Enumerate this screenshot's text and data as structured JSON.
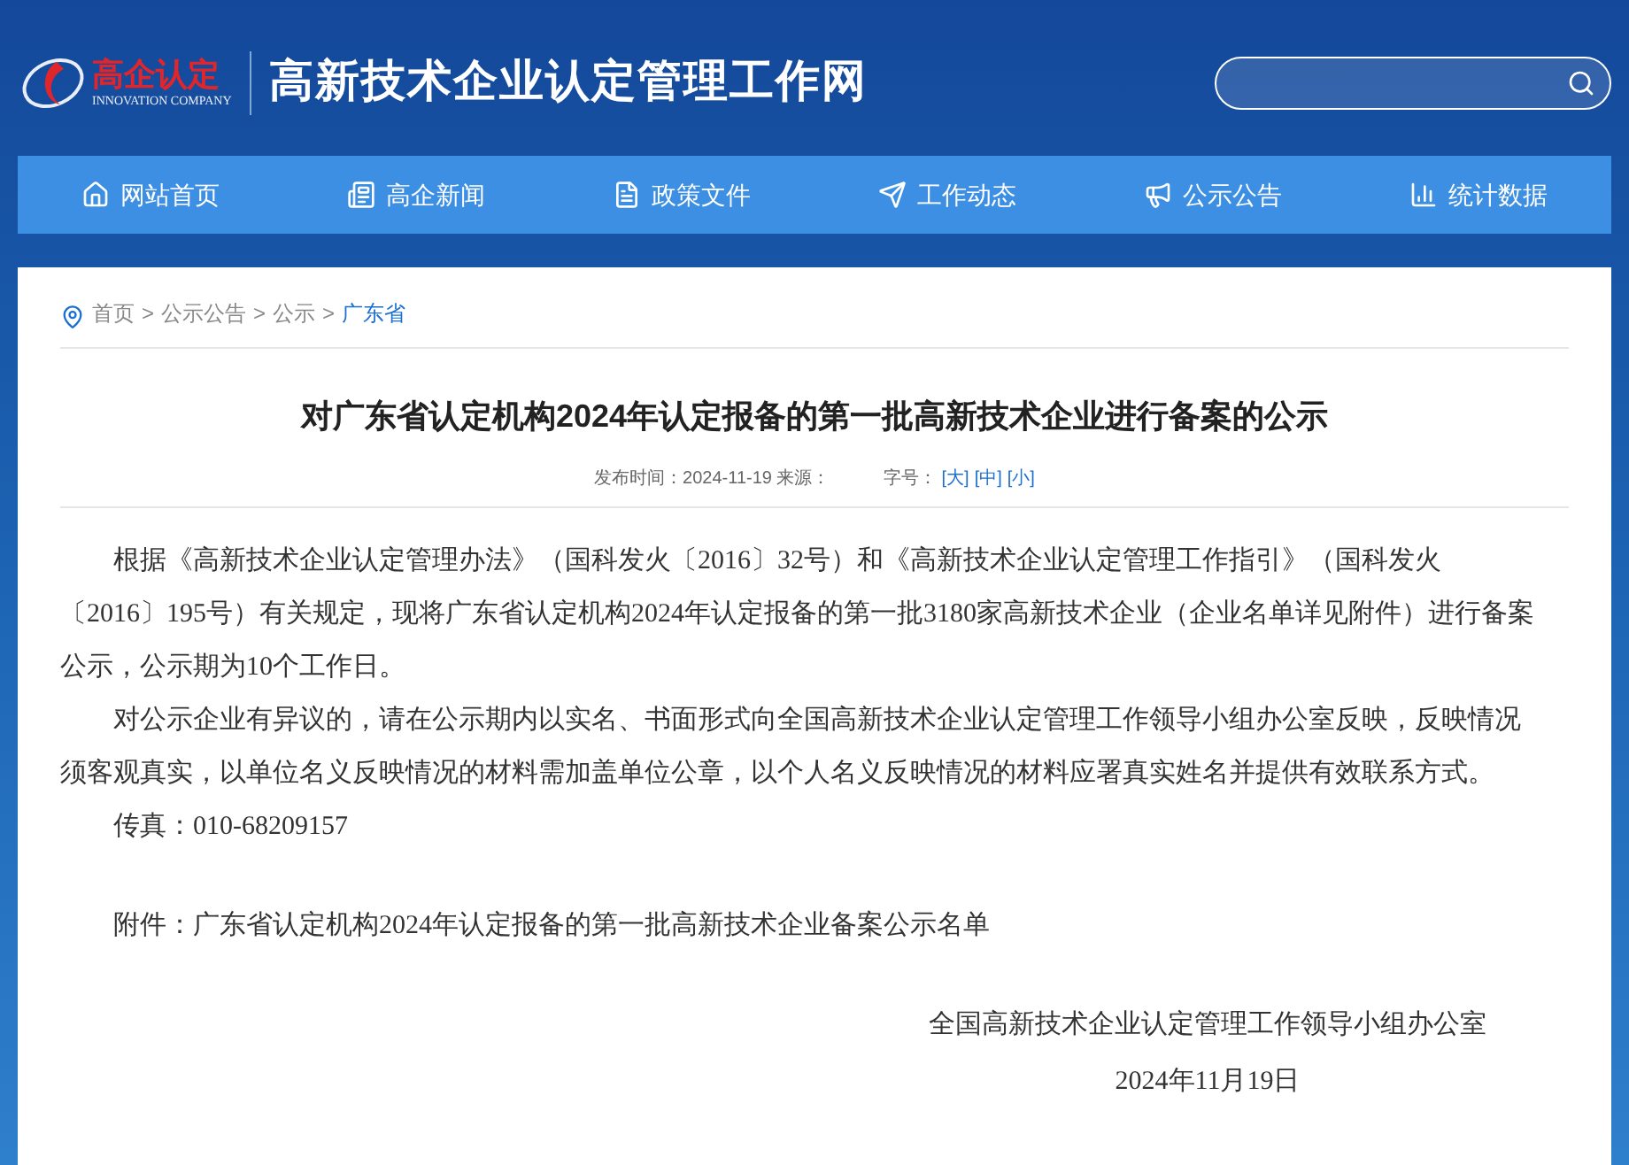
{
  "header": {
    "logo_text": "高企认定",
    "logo_subtext": "INNOVATION COMPANY",
    "site_title": "高新技术企业认定管理工作网"
  },
  "nav": [
    {
      "label": "网站首页"
    },
    {
      "label": "高企新闻"
    },
    {
      "label": "政策文件"
    },
    {
      "label": "工作动态"
    },
    {
      "label": "公示公告"
    },
    {
      "label": "统计数据"
    }
  ],
  "breadcrumb": [
    {
      "label": "首页",
      "current": false
    },
    {
      "label": "公示公告",
      "current": false
    },
    {
      "label": "公示",
      "current": false
    },
    {
      "label": "广东省",
      "current": true
    }
  ],
  "breadcrumb_separator": ">",
  "article": {
    "title": "对广东省认定机构2024年认定报备的第一批高新技术企业进行备案的公示",
    "meta": {
      "published": "发布时间：2024-11-19 来源：",
      "font_size_label": "字号：",
      "font_sizes": [
        "[大]",
        "[中]",
        "[小]"
      ]
    },
    "paragraphs": [
      {
        "text": "根据《高新技术企业认定管理办法》（国科发火〔2016〕32号）和《高新技术企业认定管理工作指引》（国科发火〔2016〕195号）有关规定，现将广东省认定机构2024年认定报备的第一批3180家高新技术企业（企业名单详见附件）进行备案公示，公示期为10个工作日。",
        "kind": "indent"
      },
      {
        "text": "对公示企业有异议的，请在公示期内以实名、书面形式向全国高新技术企业认定管理工作领导小组办公室反映，反映情况须客观真实，以单位名义反映情况的材料需加盖单位公章，以个人名义反映情况的材料应署真实姓名并提供有效联系方式。",
        "kind": "indent"
      },
      {
        "text": "传真：010-68209157",
        "kind": "indent"
      },
      {
        "text": "附件：广东省认定机构2024年认定报备的第一批高新技术企业备案公示名单",
        "kind": "attachment"
      }
    ],
    "signature": {
      "org": "全国高新技术企业认定管理工作领导小组办公室",
      "date": "2024年11月19日"
    }
  }
}
